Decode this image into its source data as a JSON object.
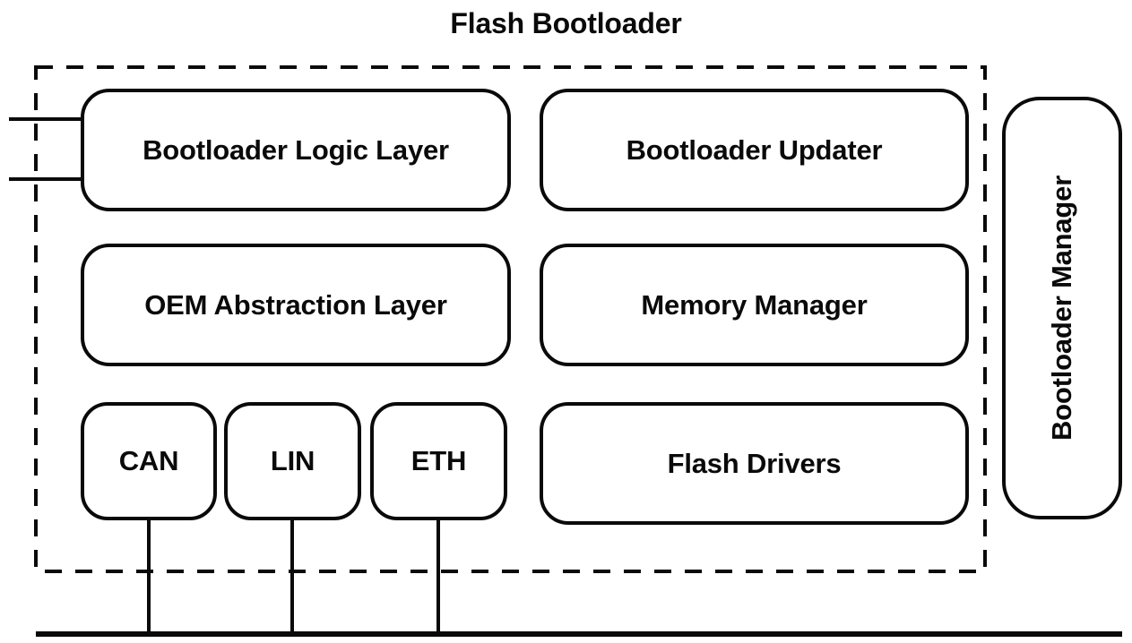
{
  "diagram": {
    "title": "Flash Bootloader",
    "type": "block-diagram",
    "stroke_color": "#0a0a0a",
    "background_color": "#ffffff",
    "boundary": {
      "name": "flash-bootloader-boundary",
      "style": "dashed"
    },
    "blocks": [
      {
        "id": "bootloader-logic-layer",
        "label": "Bootloader Logic Layer",
        "row": 1,
        "column": "left",
        "shape": "rounded-rect"
      },
      {
        "id": "bootloader-updater",
        "label": "Bootloader Updater",
        "row": 1,
        "column": "right",
        "shape": "rounded-rect"
      },
      {
        "id": "oem-abstraction-layer",
        "label": "OEM Abstraction Layer",
        "row": 2,
        "column": "left",
        "shape": "rounded-rect"
      },
      {
        "id": "memory-manager",
        "label": "Memory Manager",
        "row": 2,
        "column": "right",
        "shape": "rounded-rect"
      },
      {
        "id": "can",
        "label": "CAN",
        "row": 3,
        "column": "left",
        "shape": "rounded-square"
      },
      {
        "id": "lin",
        "label": "LIN",
        "row": 3,
        "column": "left",
        "shape": "rounded-square"
      },
      {
        "id": "eth",
        "label": "ETH",
        "row": 3,
        "column": "left",
        "shape": "rounded-square"
      },
      {
        "id": "flash-drivers",
        "label": "Flash Drivers",
        "row": 3,
        "column": "right",
        "shape": "rounded-rect"
      }
    ],
    "side_block": {
      "id": "bootloader-manager",
      "label": "Bootloader Manager",
      "orientation": "vertical",
      "shape": "rounded-rect"
    },
    "connectors": {
      "left_interface_lines": 2,
      "bus_drop_lines": [
        "can",
        "lin",
        "eth"
      ],
      "bottom_bus": true
    }
  }
}
